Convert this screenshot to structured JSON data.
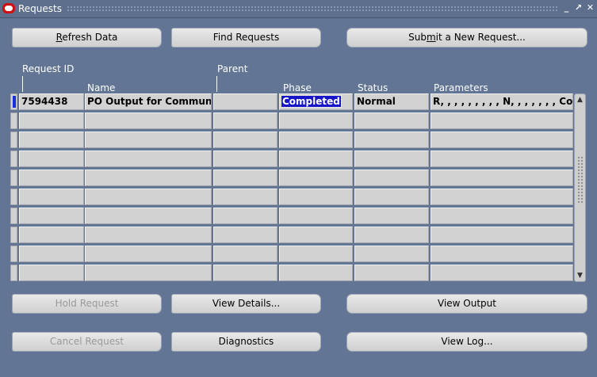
{
  "window": {
    "title": "Requests",
    "controls": [
      "minimize-icon",
      "maximize-icon",
      "close-icon"
    ],
    "control_glyphs": [
      "_",
      "↗",
      "✕"
    ]
  },
  "top_buttons": {
    "refresh_pre": "",
    "refresh_acc": "R",
    "refresh_post": "efresh Data",
    "find": "Find Requests",
    "submit_pre": "Sub",
    "submit_acc": "m",
    "submit_post": "it a New Request..."
  },
  "table": {
    "headers": {
      "request_id": "Request ID",
      "name": "Name",
      "parent": "Parent",
      "phase": "Phase",
      "status": "Status",
      "parameters": "Parameters"
    },
    "rows": [
      {
        "request_id": "7594438",
        "name": "PO Output for Communic",
        "parent": "",
        "phase": "Completed",
        "status": "Normal",
        "parameters": "R, , , , , , , , , N, , , , , , , Com"
      },
      {
        "request_id": "",
        "name": "",
        "parent": "",
        "phase": "",
        "status": "",
        "parameters": ""
      },
      {
        "request_id": "",
        "name": "",
        "parent": "",
        "phase": "",
        "status": "",
        "parameters": ""
      },
      {
        "request_id": "",
        "name": "",
        "parent": "",
        "phase": "",
        "status": "",
        "parameters": ""
      },
      {
        "request_id": "",
        "name": "",
        "parent": "",
        "phase": "",
        "status": "",
        "parameters": ""
      },
      {
        "request_id": "",
        "name": "",
        "parent": "",
        "phase": "",
        "status": "",
        "parameters": ""
      },
      {
        "request_id": "",
        "name": "",
        "parent": "",
        "phase": "",
        "status": "",
        "parameters": ""
      },
      {
        "request_id": "",
        "name": "",
        "parent": "",
        "phase": "",
        "status": "",
        "parameters": ""
      },
      {
        "request_id": "",
        "name": "",
        "parent": "",
        "phase": "",
        "status": "",
        "parameters": ""
      },
      {
        "request_id": "",
        "name": "",
        "parent": "",
        "phase": "",
        "status": "",
        "parameters": ""
      }
    ]
  },
  "bottom_buttons": {
    "hold": "Hold Request",
    "view_details": "View Details...",
    "view_output": "View Output",
    "cancel": "Cancel Request",
    "diagnostics": "Diagnostics",
    "view_log": "View Log..."
  },
  "colors": {
    "background": "#627594",
    "selection": "#1616c8",
    "title_logo": "#d01010"
  }
}
